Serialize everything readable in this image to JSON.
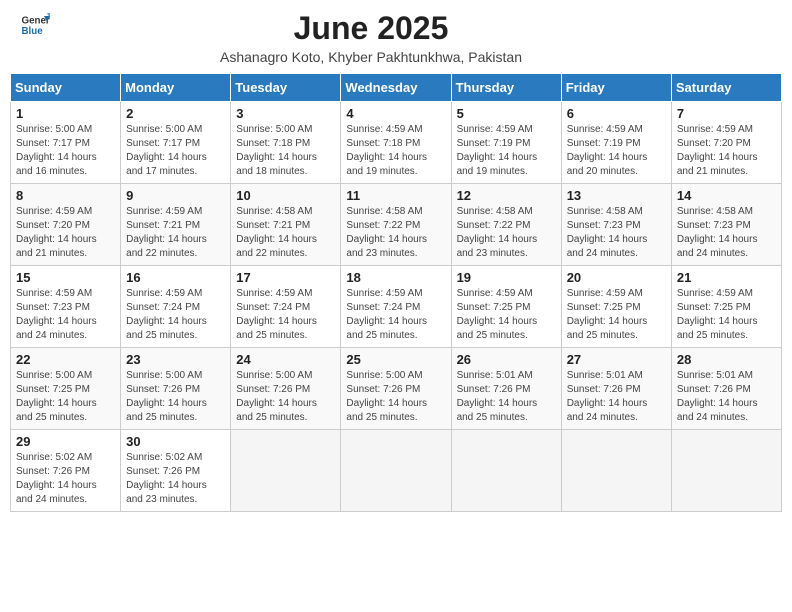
{
  "header": {
    "logo_general": "General",
    "logo_blue": "Blue",
    "title": "June 2025",
    "subtitle": "Ashanagro Koto, Khyber Pakhtunkhwa, Pakistan"
  },
  "calendar": {
    "weekdays": [
      "Sunday",
      "Monday",
      "Tuesday",
      "Wednesday",
      "Thursday",
      "Friday",
      "Saturday"
    ],
    "weeks": [
      [
        {
          "day": "1",
          "sunrise": "5:00 AM",
          "sunset": "7:17 PM",
          "daylight": "14 hours and 16 minutes."
        },
        {
          "day": "2",
          "sunrise": "5:00 AM",
          "sunset": "7:17 PM",
          "daylight": "14 hours and 17 minutes."
        },
        {
          "day": "3",
          "sunrise": "5:00 AM",
          "sunset": "7:18 PM",
          "daylight": "14 hours and 18 minutes."
        },
        {
          "day": "4",
          "sunrise": "4:59 AM",
          "sunset": "7:18 PM",
          "daylight": "14 hours and 19 minutes."
        },
        {
          "day": "5",
          "sunrise": "4:59 AM",
          "sunset": "7:19 PM",
          "daylight": "14 hours and 19 minutes."
        },
        {
          "day": "6",
          "sunrise": "4:59 AM",
          "sunset": "7:19 PM",
          "daylight": "14 hours and 20 minutes."
        },
        {
          "day": "7",
          "sunrise": "4:59 AM",
          "sunset": "7:20 PM",
          "daylight": "14 hours and 21 minutes."
        }
      ],
      [
        {
          "day": "8",
          "sunrise": "4:59 AM",
          "sunset": "7:20 PM",
          "daylight": "14 hours and 21 minutes."
        },
        {
          "day": "9",
          "sunrise": "4:59 AM",
          "sunset": "7:21 PM",
          "daylight": "14 hours and 22 minutes."
        },
        {
          "day": "10",
          "sunrise": "4:58 AM",
          "sunset": "7:21 PM",
          "daylight": "14 hours and 22 minutes."
        },
        {
          "day": "11",
          "sunrise": "4:58 AM",
          "sunset": "7:22 PM",
          "daylight": "14 hours and 23 minutes."
        },
        {
          "day": "12",
          "sunrise": "4:58 AM",
          "sunset": "7:22 PM",
          "daylight": "14 hours and 23 minutes."
        },
        {
          "day": "13",
          "sunrise": "4:58 AM",
          "sunset": "7:23 PM",
          "daylight": "14 hours and 24 minutes."
        },
        {
          "day": "14",
          "sunrise": "4:58 AM",
          "sunset": "7:23 PM",
          "daylight": "14 hours and 24 minutes."
        }
      ],
      [
        {
          "day": "15",
          "sunrise": "4:59 AM",
          "sunset": "7:23 PM",
          "daylight": "14 hours and 24 minutes."
        },
        {
          "day": "16",
          "sunrise": "4:59 AM",
          "sunset": "7:24 PM",
          "daylight": "14 hours and 25 minutes."
        },
        {
          "day": "17",
          "sunrise": "4:59 AM",
          "sunset": "7:24 PM",
          "daylight": "14 hours and 25 minutes."
        },
        {
          "day": "18",
          "sunrise": "4:59 AM",
          "sunset": "7:24 PM",
          "daylight": "14 hours and 25 minutes."
        },
        {
          "day": "19",
          "sunrise": "4:59 AM",
          "sunset": "7:25 PM",
          "daylight": "14 hours and 25 minutes."
        },
        {
          "day": "20",
          "sunrise": "4:59 AM",
          "sunset": "7:25 PM",
          "daylight": "14 hours and 25 minutes."
        },
        {
          "day": "21",
          "sunrise": "4:59 AM",
          "sunset": "7:25 PM",
          "daylight": "14 hours and 25 minutes."
        }
      ],
      [
        {
          "day": "22",
          "sunrise": "5:00 AM",
          "sunset": "7:25 PM",
          "daylight": "14 hours and 25 minutes."
        },
        {
          "day": "23",
          "sunrise": "5:00 AM",
          "sunset": "7:26 PM",
          "daylight": "14 hours and 25 minutes."
        },
        {
          "day": "24",
          "sunrise": "5:00 AM",
          "sunset": "7:26 PM",
          "daylight": "14 hours and 25 minutes."
        },
        {
          "day": "25",
          "sunrise": "5:00 AM",
          "sunset": "7:26 PM",
          "daylight": "14 hours and 25 minutes."
        },
        {
          "day": "26",
          "sunrise": "5:01 AM",
          "sunset": "7:26 PM",
          "daylight": "14 hours and 25 minutes."
        },
        {
          "day": "27",
          "sunrise": "5:01 AM",
          "sunset": "7:26 PM",
          "daylight": "14 hours and 24 minutes."
        },
        {
          "day": "28",
          "sunrise": "5:01 AM",
          "sunset": "7:26 PM",
          "daylight": "14 hours and 24 minutes."
        }
      ],
      [
        {
          "day": "29",
          "sunrise": "5:02 AM",
          "sunset": "7:26 PM",
          "daylight": "14 hours and 24 minutes."
        },
        {
          "day": "30",
          "sunrise": "5:02 AM",
          "sunset": "7:26 PM",
          "daylight": "14 hours and 23 minutes."
        },
        null,
        null,
        null,
        null,
        null
      ]
    ]
  }
}
